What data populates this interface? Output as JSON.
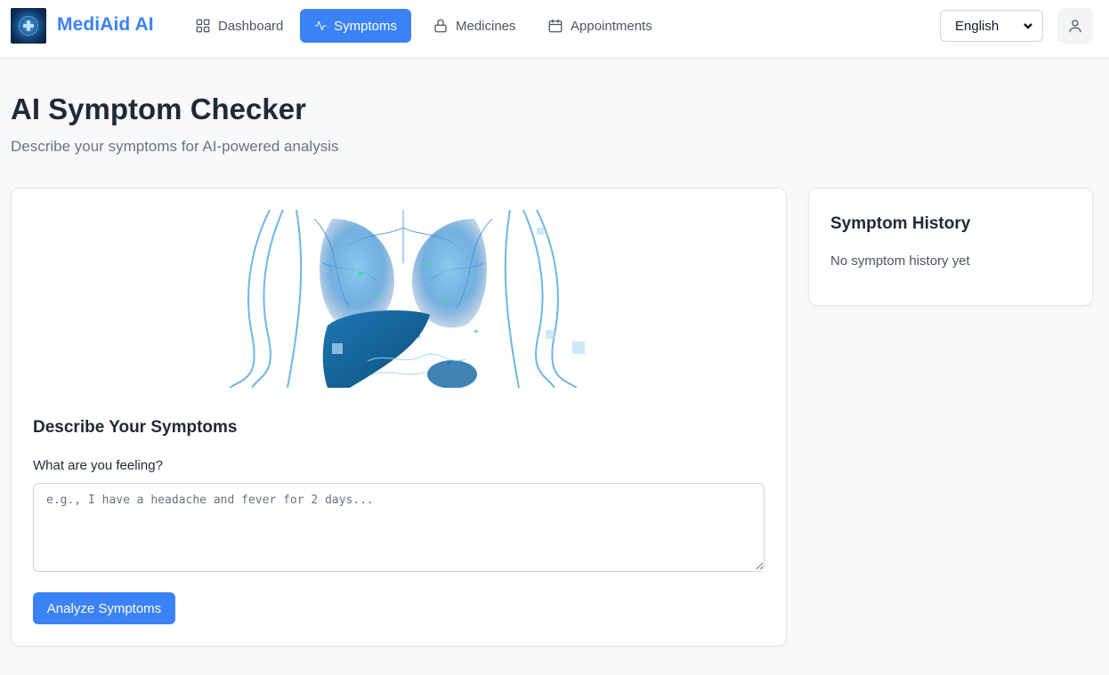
{
  "app": {
    "brand": "MediAid AI"
  },
  "nav": {
    "items": [
      {
        "label": "Dashboard",
        "icon": "grid-icon"
      },
      {
        "label": "Symptoms",
        "icon": "activity-icon",
        "active": true
      },
      {
        "label": "Medicines",
        "icon": "lock-icon"
      },
      {
        "label": "Appointments",
        "icon": "calendar-icon"
      }
    ]
  },
  "header": {
    "language": "English",
    "user_icon": "user-icon"
  },
  "page": {
    "title": "AI Symptom Checker",
    "subtitle": "Describe your symptoms for AI-powered analysis"
  },
  "symptom_form": {
    "section_title": "Describe Your Symptoms",
    "field_label": "What are you feeling?",
    "placeholder": "e.g., I have a headache and fever for 2 days...",
    "value": "",
    "submit_label": "Analyze Symptoms"
  },
  "history": {
    "title": "Symptom History",
    "empty_text": "No symptom history yet"
  },
  "colors": {
    "accent": "#3b82f6",
    "background": "#f8f9fb",
    "text": "#1f2937"
  }
}
